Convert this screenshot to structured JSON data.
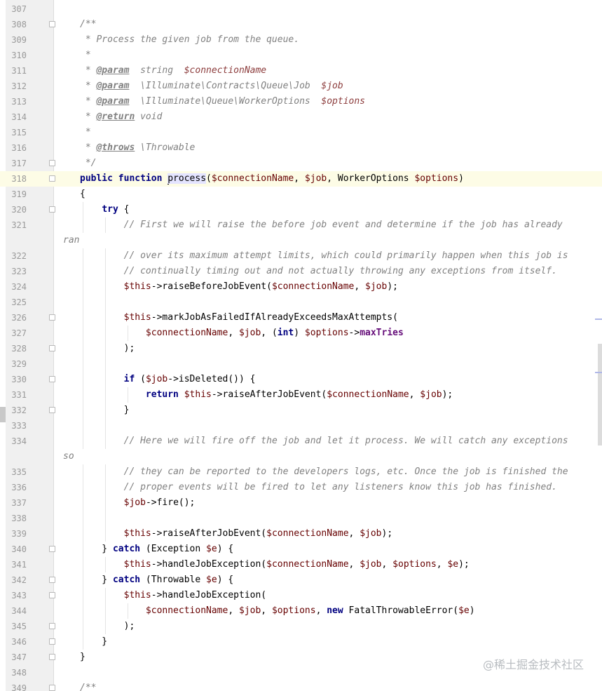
{
  "lines": [
    {
      "n": "307",
      "t": []
    },
    {
      "n": "308",
      "f": 1,
      "t": [
        [
          "cm",
          "/**"
        ]
      ]
    },
    {
      "n": "309",
      "t": [
        [
          "cm",
          " * Process the given job from the queue."
        ]
      ]
    },
    {
      "n": "310",
      "t": [
        [
          "cm",
          " *"
        ]
      ]
    },
    {
      "n": "311",
      "t": [
        [
          "cm",
          " * "
        ],
        [
          "tag",
          "@param"
        ],
        [
          "cm",
          "  string  "
        ],
        [
          "cv",
          "$connectionName"
        ]
      ]
    },
    {
      "n": "312",
      "t": [
        [
          "cm",
          " * "
        ],
        [
          "tag",
          "@param"
        ],
        [
          "cm",
          "  \\Illuminate\\Contracts\\Queue\\Job  "
        ],
        [
          "cv",
          "$job"
        ]
      ]
    },
    {
      "n": "313",
      "t": [
        [
          "cm",
          " * "
        ],
        [
          "tag",
          "@param"
        ],
        [
          "cm",
          "  \\Illuminate\\Queue\\WorkerOptions  "
        ],
        [
          "cv",
          "$options"
        ]
      ]
    },
    {
      "n": "314",
      "t": [
        [
          "cm",
          " * "
        ],
        [
          "tag",
          "@return"
        ],
        [
          "cm",
          " void"
        ]
      ]
    },
    {
      "n": "315",
      "t": [
        [
          "cm",
          " *"
        ]
      ]
    },
    {
      "n": "316",
      "t": [
        [
          "cm",
          " * "
        ],
        [
          "tag",
          "@throws"
        ],
        [
          "cm",
          " \\Throwable"
        ]
      ]
    },
    {
      "n": "317",
      "f": 1,
      "t": [
        [
          "cm",
          " */"
        ]
      ]
    },
    {
      "n": "318",
      "f": 1,
      "cur": 1,
      "t": [
        [
          "kw",
          "public function "
        ],
        [
          "caret",
          ""
        ],
        [
          "hl",
          "process"
        ],
        [
          "p",
          "("
        ],
        [
          "v",
          "$connectionName"
        ],
        [
          "p",
          ", "
        ],
        [
          "v",
          "$job"
        ],
        [
          "p",
          ", WorkerOptions "
        ],
        [
          "v",
          "$options"
        ],
        [
          "p",
          ")"
        ]
      ]
    },
    {
      "n": "319",
      "t": [
        [
          "p",
          "{"
        ]
      ]
    },
    {
      "n": "320",
      "f": 1,
      "g": [
        1
      ],
      "t": [
        [
          "p",
          "    "
        ],
        [
          "kw",
          "try"
        ],
        [
          "p",
          " {"
        ]
      ]
    },
    {
      "n": "321",
      "g": [
        1,
        2
      ],
      "t": [
        [
          "p",
          "        "
        ],
        [
          "cm",
          "// First we will raise the before job event and determine if the job has already"
        ]
      ]
    },
    {
      "n": "",
      "wrap": 1,
      "t": [
        [
          "cm",
          "ran"
        ]
      ]
    },
    {
      "n": "322",
      "g": [
        1,
        2
      ],
      "t": [
        [
          "p",
          "        "
        ],
        [
          "cm",
          "// over its maximum attempt limits, which could primarily happen when this job is"
        ]
      ]
    },
    {
      "n": "323",
      "g": [
        1,
        2
      ],
      "t": [
        [
          "p",
          "        "
        ],
        [
          "cm",
          "// continually timing out and not actually throwing any exceptions from itself."
        ]
      ]
    },
    {
      "n": "324",
      "g": [
        1,
        2
      ],
      "t": [
        [
          "p",
          "        "
        ],
        [
          "v",
          "$this"
        ],
        [
          "p",
          "->raiseBeforeJobEvent("
        ],
        [
          "v",
          "$connectionName"
        ],
        [
          "p",
          ", "
        ],
        [
          "v",
          "$job"
        ],
        [
          "p",
          ");"
        ]
      ]
    },
    {
      "n": "325",
      "g": [
        1,
        2
      ],
      "t": []
    },
    {
      "n": "326",
      "f": 1,
      "g": [
        1,
        2
      ],
      "t": [
        [
          "p",
          "        "
        ],
        [
          "v",
          "$this"
        ],
        [
          "p",
          "->markJobAsFailedIfAlreadyExceedsMaxAttempts("
        ]
      ]
    },
    {
      "n": "327",
      "g": [
        1,
        2,
        3
      ],
      "t": [
        [
          "p",
          "            "
        ],
        [
          "v",
          "$connectionName"
        ],
        [
          "p",
          ", "
        ],
        [
          "v",
          "$job"
        ],
        [
          "p",
          ", ("
        ],
        [
          "kw",
          "int"
        ],
        [
          "p",
          ") "
        ],
        [
          "v",
          "$options"
        ],
        [
          "p",
          "->"
        ],
        [
          "fld",
          "maxTries"
        ]
      ]
    },
    {
      "n": "328",
      "f": 1,
      "g": [
        1,
        2
      ],
      "t": [
        [
          "p",
          "        );"
        ]
      ]
    },
    {
      "n": "329",
      "g": [
        1,
        2
      ],
      "t": []
    },
    {
      "n": "330",
      "f": 1,
      "g": [
        1,
        2
      ],
      "t": [
        [
          "p",
          "        "
        ],
        [
          "kw",
          "if"
        ],
        [
          "p",
          " ("
        ],
        [
          "v",
          "$job"
        ],
        [
          "p",
          "->isDeleted()) {"
        ]
      ]
    },
    {
      "n": "331",
      "g": [
        1,
        2,
        3
      ],
      "t": [
        [
          "p",
          "            "
        ],
        [
          "kw",
          "return"
        ],
        [
          "p",
          " "
        ],
        [
          "v",
          "$this"
        ],
        [
          "p",
          "->raiseAfterJobEvent("
        ],
        [
          "v",
          "$connectionName"
        ],
        [
          "p",
          ", "
        ],
        [
          "v",
          "$job"
        ],
        [
          "p",
          ");"
        ]
      ]
    },
    {
      "n": "332",
      "f": 1,
      "g": [
        1,
        2
      ],
      "t": [
        [
          "p",
          "        }"
        ]
      ]
    },
    {
      "n": "333",
      "g": [
        1,
        2
      ],
      "t": []
    },
    {
      "n": "334",
      "g": [
        1,
        2
      ],
      "t": [
        [
          "p",
          "        "
        ],
        [
          "cm",
          "// Here we will fire off the job and let it process. We will catch any exceptions"
        ]
      ]
    },
    {
      "n": "",
      "wrap": 1,
      "t": [
        [
          "cm",
          "so"
        ]
      ]
    },
    {
      "n": "335",
      "g": [
        1,
        2
      ],
      "t": [
        [
          "p",
          "        "
        ],
        [
          "cm",
          "// they can be reported to the developers logs, etc. Once the job is finished the"
        ]
      ]
    },
    {
      "n": "336",
      "g": [
        1,
        2
      ],
      "t": [
        [
          "p",
          "        "
        ],
        [
          "cm",
          "// proper events will be fired to let any listeners know this job has finished."
        ]
      ]
    },
    {
      "n": "337",
      "g": [
        1,
        2
      ],
      "t": [
        [
          "p",
          "        "
        ],
        [
          "v",
          "$job"
        ],
        [
          "p",
          "->fire();"
        ]
      ]
    },
    {
      "n": "338",
      "g": [
        1,
        2
      ],
      "t": []
    },
    {
      "n": "339",
      "g": [
        1,
        2
      ],
      "t": [
        [
          "p",
          "        "
        ],
        [
          "v",
          "$this"
        ],
        [
          "p",
          "->raiseAfterJobEvent("
        ],
        [
          "v",
          "$connectionName"
        ],
        [
          "p",
          ", "
        ],
        [
          "v",
          "$job"
        ],
        [
          "p",
          ");"
        ]
      ]
    },
    {
      "n": "340",
      "f": 1,
      "g": [
        1
      ],
      "t": [
        [
          "p",
          "    } "
        ],
        [
          "kw",
          "catch"
        ],
        [
          "p",
          " (Exception "
        ],
        [
          "v",
          "$e"
        ],
        [
          "p",
          ") {"
        ]
      ]
    },
    {
      "n": "341",
      "g": [
        1,
        2
      ],
      "t": [
        [
          "p",
          "        "
        ],
        [
          "v",
          "$this"
        ],
        [
          "p",
          "->handleJobException("
        ],
        [
          "v",
          "$connectionName"
        ],
        [
          "p",
          ", "
        ],
        [
          "v",
          "$job"
        ],
        [
          "p",
          ", "
        ],
        [
          "v",
          "$options"
        ],
        [
          "p",
          ", "
        ],
        [
          "v",
          "$e"
        ],
        [
          "p",
          ");"
        ]
      ]
    },
    {
      "n": "342",
      "f": 1,
      "g": [
        1
      ],
      "t": [
        [
          "p",
          "    } "
        ],
        [
          "kw",
          "catch"
        ],
        [
          "p",
          " (Throwable "
        ],
        [
          "v",
          "$e"
        ],
        [
          "p",
          ") {"
        ]
      ]
    },
    {
      "n": "343",
      "f": 1,
      "g": [
        1,
        2
      ],
      "t": [
        [
          "p",
          "        "
        ],
        [
          "v",
          "$this"
        ],
        [
          "p",
          "->handleJobException("
        ]
      ]
    },
    {
      "n": "344",
      "g": [
        1,
        2,
        3
      ],
      "t": [
        [
          "p",
          "            "
        ],
        [
          "v",
          "$connectionName"
        ],
        [
          "p",
          ", "
        ],
        [
          "v",
          "$job"
        ],
        [
          "p",
          ", "
        ],
        [
          "v",
          "$options"
        ],
        [
          "p",
          ", "
        ],
        [
          "kw",
          "new"
        ],
        [
          "p",
          " FatalThrowableError("
        ],
        [
          "v",
          "$e"
        ],
        [
          "p",
          ")"
        ]
      ]
    },
    {
      "n": "345",
      "f": 1,
      "g": [
        1,
        2
      ],
      "t": [
        [
          "p",
          "        );"
        ]
      ]
    },
    {
      "n": "346",
      "f": 1,
      "g": [
        1
      ],
      "t": [
        [
          "p",
          "    }"
        ]
      ]
    },
    {
      "n": "347",
      "f": 1,
      "t": [
        [
          "p",
          "}"
        ]
      ]
    },
    {
      "n": "348",
      "t": []
    },
    {
      "n": "349",
      "f": 1,
      "t": [
        [
          "cm",
          "/**"
        ]
      ]
    }
  ],
  "watermark": "@稀土掘金技术社区"
}
